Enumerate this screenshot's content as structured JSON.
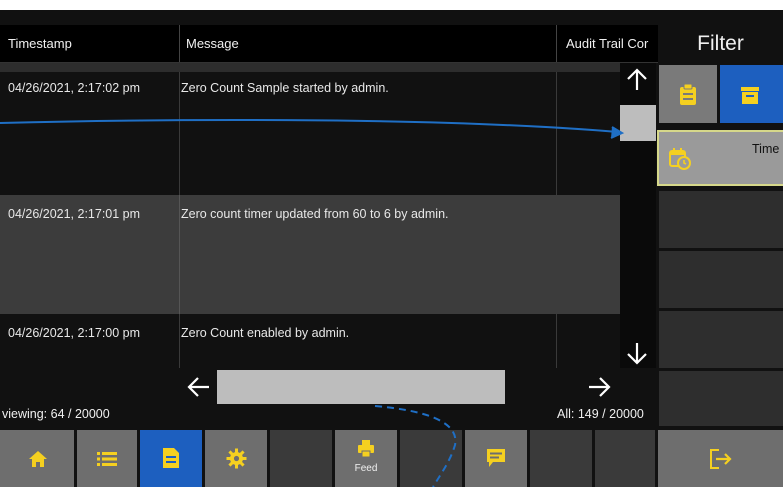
{
  "table": {
    "headers": [
      "Timestamp",
      "Message",
      "Audit Trail Cor"
    ],
    "rows": [
      {
        "timestamp": "04/26/2021, 2:17:02 pm",
        "message": "Zero Count Sample started by admin."
      },
      {
        "timestamp": "04/26/2021, 2:17:01 pm",
        "message": "Zero count timer updated from 60 to 6 by admin."
      },
      {
        "timestamp": "04/26/2021, 2:17:00 pm",
        "message": "Zero Count enabled by admin."
      }
    ]
  },
  "status": {
    "viewing": "viewing: 64 / 20000",
    "all": "All: 149 / 20000"
  },
  "filter": {
    "title": "Filter",
    "time_label": "Time"
  },
  "nav": {
    "feed_label": "Feed"
  },
  "colors": {
    "accent_blue": "#1d5fbf",
    "icon_yellow": "#f5d020",
    "annotation_blue": "#1f6fc5"
  },
  "icons": [
    "up-arrow",
    "down-arrow",
    "left-arrow",
    "right-arrow",
    "clipboard-icon",
    "archive-icon",
    "calendar-clock-icon",
    "home-icon",
    "list-icon",
    "document-icon",
    "gear-icon",
    "printer-icon",
    "message-icon",
    "logout-icon"
  ]
}
